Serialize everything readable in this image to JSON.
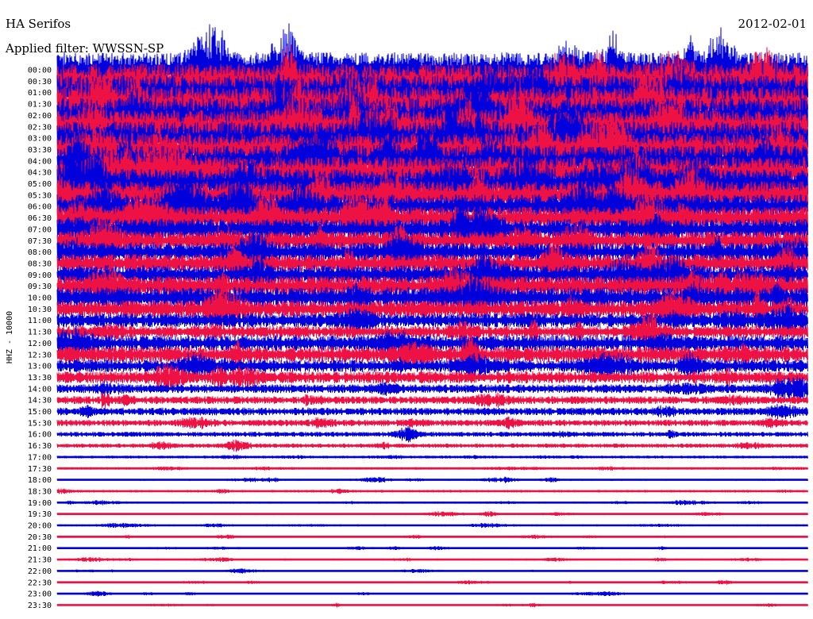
{
  "header": {
    "station": "HA Serifos",
    "date": "2012-02-01",
    "filter": "Applied filter: WWSSN-SP"
  },
  "chart_data": {
    "type": "line",
    "title": "HA Serifos",
    "date": "2012-02-01",
    "filter": "WWSSN-SP",
    "ylabel": "HHZ - 10000",
    "colors": [
      "#0000dd",
      "#ee1144"
    ],
    "rows": [
      {
        "label": "00:00",
        "color": "#0000dd",
        "amp": 1.0
      },
      {
        "label": "00:30",
        "color": "#ee1144",
        "amp": 1.0
      },
      {
        "label": "01:00",
        "color": "#0000dd",
        "amp": 1.0
      },
      {
        "label": "01:30",
        "color": "#ee1144",
        "amp": 1.0
      },
      {
        "label": "02:00",
        "color": "#0000dd",
        "amp": 1.0
      },
      {
        "label": "02:30",
        "color": "#ee1144",
        "amp": 1.0
      },
      {
        "label": "03:00",
        "color": "#0000dd",
        "amp": 0.95
      },
      {
        "label": "03:30",
        "color": "#ee1144",
        "amp": 0.95
      },
      {
        "label": "04:00",
        "color": "#0000dd",
        "amp": 0.9
      },
      {
        "label": "04:30",
        "color": "#ee1144",
        "amp": 0.9
      },
      {
        "label": "05:00",
        "color": "#0000dd",
        "amp": 0.85
      },
      {
        "label": "05:30",
        "color": "#ee1144",
        "amp": 0.8
      },
      {
        "label": "06:00",
        "color": "#0000dd",
        "amp": 0.7
      },
      {
        "label": "06:30",
        "color": "#ee1144",
        "amp": 0.65
      },
      {
        "label": "07:00",
        "color": "#0000dd",
        "amp": 0.6
      },
      {
        "label": "07:30",
        "color": "#ee1144",
        "amp": 0.55
      },
      {
        "label": "08:00",
        "color": "#0000dd",
        "amp": 0.55
      },
      {
        "label": "08:30",
        "color": "#ee1144",
        "amp": 0.55
      },
      {
        "label": "09:00",
        "color": "#0000dd",
        "amp": 0.55
      },
      {
        "label": "09:30",
        "color": "#ee1144",
        "amp": 0.6
      },
      {
        "label": "10:00",
        "color": "#0000dd",
        "amp": 0.6
      },
      {
        "label": "10:30",
        "color": "#ee1144",
        "amp": 0.5
      },
      {
        "label": "11:00",
        "color": "#0000dd",
        "amp": 0.4
      },
      {
        "label": "11:30",
        "color": "#ee1144",
        "amp": 0.35
      },
      {
        "label": "12:00",
        "color": "#0000dd",
        "amp": 0.45
      },
      {
        "label": "12:30",
        "color": "#ee1144",
        "amp": 0.45
      },
      {
        "label": "13:00",
        "color": "#0000dd",
        "amp": 0.35
      },
      {
        "label": "13:30",
        "color": "#ee1144",
        "amp": 0.35
      },
      {
        "label": "14:00",
        "color": "#0000dd",
        "amp": 0.25
      },
      {
        "label": "14:30",
        "color": "#ee1144",
        "amp": 0.22
      },
      {
        "label": "15:00",
        "color": "#0000dd",
        "amp": 0.22
      },
      {
        "label": "15:30",
        "color": "#ee1144",
        "amp": 0.18
      },
      {
        "label": "16:00",
        "color": "#0000dd",
        "amp": 0.14
      },
      {
        "label": "16:30",
        "color": "#ee1144",
        "amp": 0.12
      },
      {
        "label": "17:00",
        "color": "#0000dd",
        "amp": 0.08
      },
      {
        "label": "17:30",
        "color": "#ee1144",
        "amp": 0.07
      },
      {
        "label": "18:00",
        "color": "#0000dd",
        "amp": 0.06
      },
      {
        "label": "18:30",
        "color": "#ee1144",
        "amp": 0.07
      },
      {
        "label": "19:00",
        "color": "#0000dd",
        "amp": 0.06
      },
      {
        "label": "19:30",
        "color": "#ee1144",
        "amp": 0.06
      },
      {
        "label": "20:00",
        "color": "#0000dd",
        "amp": 0.06
      },
      {
        "label": "20:30",
        "color": "#ee1144",
        "amp": 0.05
      },
      {
        "label": "21:00",
        "color": "#0000dd",
        "amp": 0.05
      },
      {
        "label": "21:30",
        "color": "#ee1144",
        "amp": 0.06
      },
      {
        "label": "22:00",
        "color": "#0000dd",
        "amp": 0.05
      },
      {
        "label": "22:30",
        "color": "#ee1144",
        "amp": 0.05
      },
      {
        "label": "23:00",
        "color": "#0000dd",
        "amp": 0.05
      },
      {
        "label": "23:30",
        "color": "#ee1144",
        "amp": 0.05
      }
    ]
  }
}
